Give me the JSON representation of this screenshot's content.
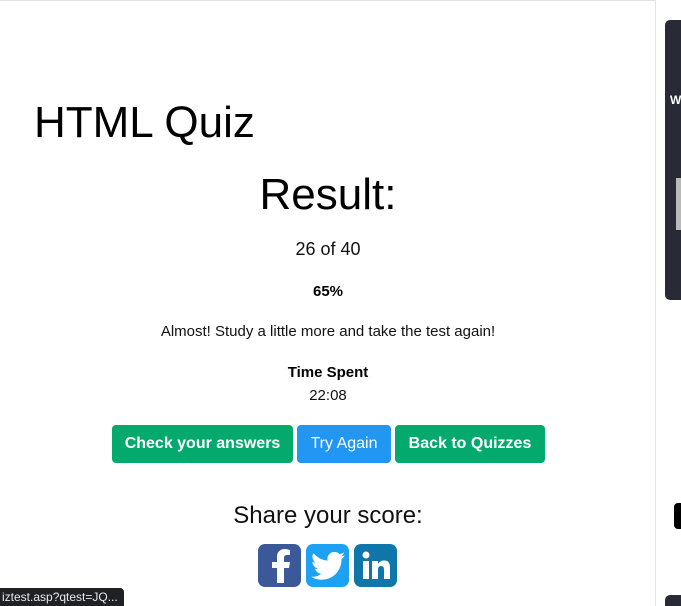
{
  "page": {
    "title": "HTML Quiz"
  },
  "result": {
    "heading": "Result:",
    "score": "26 of 40",
    "percent": "65%",
    "message": "Almost! Study a little more and take the test again!",
    "time_label": "Time Spent",
    "time_value": "22:08"
  },
  "buttons": {
    "check": "Check your answers",
    "try_again": "Try Again",
    "back": "Back to Quizzes"
  },
  "share": {
    "title": "Share your score:"
  },
  "sidebar": {
    "letter": "W"
  },
  "status_bar": {
    "url": "iztest.asp?qtest=JQ..."
  },
  "colors": {
    "green": "#04aa6d",
    "blue": "#2196f3",
    "facebook": "#3b5998",
    "twitter": "#1da1f2",
    "linkedin": "#0e76a8",
    "dark_panel": "#282a35"
  },
  "icons": [
    "facebook-icon",
    "twitter-icon",
    "linkedin-icon"
  ]
}
